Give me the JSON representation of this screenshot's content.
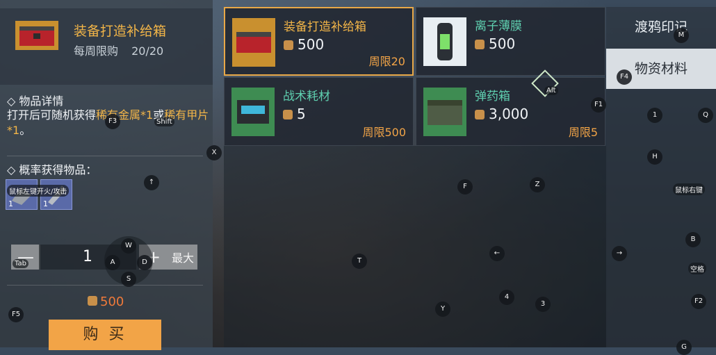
{
  "detail": {
    "title": "装备打造补给箱",
    "limit_label": "每周限购",
    "limit_value": "20/20",
    "section_details": "◇ 物品详情",
    "desc_parts": [
      "打开后可随机获得",
      "稀有金属*1",
      "或",
      "稀有甲片*1",
      "。"
    ],
    "section_drops": "◇ 概率获得物品：",
    "drops": [
      {
        "count": "1"
      },
      {
        "count": "1"
      }
    ],
    "qty": "1",
    "minus": "—",
    "plus": "+",
    "max": "最大",
    "price": "500",
    "buy": "购 买"
  },
  "items": [
    {
      "name": "装备打造补给箱",
      "cost": "500",
      "limit": "周限20",
      "selected": true,
      "name_color": "gold",
      "icon": "supply-box-icon"
    },
    {
      "name": "离子薄膜",
      "cost": "500",
      "limit": "",
      "selected": false,
      "name_color": "green",
      "icon": "ion-film-icon"
    },
    {
      "name": "战术耗材",
      "cost": "5",
      "limit": "周限500",
      "selected": false,
      "name_color": "green",
      "icon": "battery-icon"
    },
    {
      "name": "弹药箱",
      "cost": "3,000",
      "limit": "周限5",
      "selected": false,
      "name_color": "green",
      "icon": "ammo-box-icon"
    }
  ],
  "tabs": [
    {
      "label": "渡鸦印记",
      "active": false
    },
    {
      "label": "物资材料",
      "active": true
    }
  ],
  "keys": [
    "F3",
    "Shift",
    "X",
    "↑",
    "Tab",
    "W",
    "A",
    "D",
    "S",
    "F5",
    "F",
    "Z",
    "←",
    "T",
    "4",
    "3",
    "Y",
    "→",
    "1",
    "Q",
    "H",
    "B",
    "F2",
    "G",
    "M",
    "F4",
    "F1",
    "Alt",
    "鼠标右键",
    "空格",
    "鼠标左键开火/攻击"
  ],
  "colors": {
    "accent": "#f2b548",
    "price": "#f07a3a",
    "buy": "#f2a447",
    "name_green": "#5fd0b0"
  }
}
